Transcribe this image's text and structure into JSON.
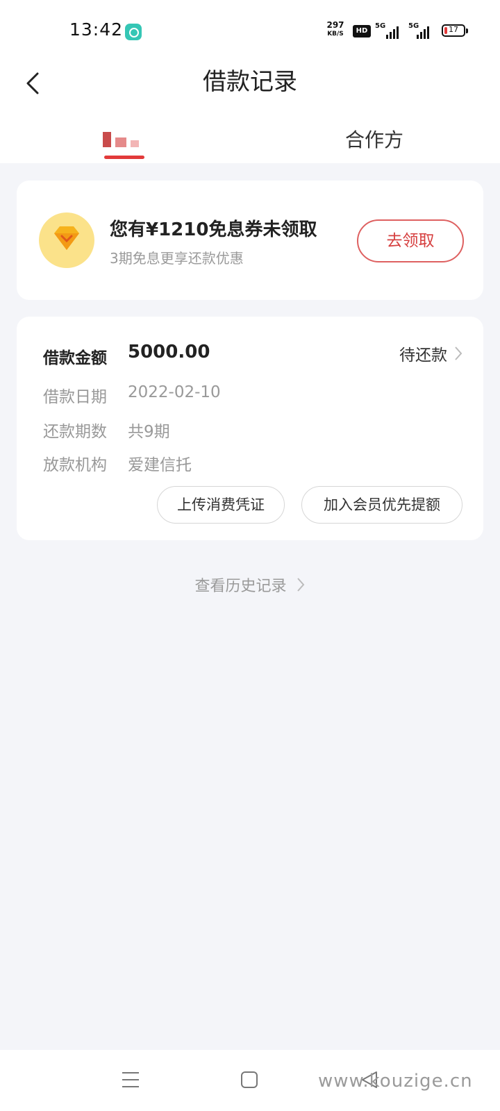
{
  "status_bar": {
    "time": "13:42",
    "net_speed_value": "297",
    "net_speed_unit": "KB/S",
    "hd_label": "HD",
    "signal_1_label": "5G",
    "signal_2_label": "5G",
    "battery_level": "17",
    "battery_fraction": 0.17,
    "battery_color": "#e23b3b"
  },
  "header": {
    "title": "借款记录",
    "tabs": [
      {
        "label": "",
        "active": true
      },
      {
        "label": "合作方",
        "active": false
      }
    ],
    "accent_color": "#e23a3a"
  },
  "coupon": {
    "title": "您有¥1210免息券未领取",
    "subtitle": "3期免息更享还款优惠",
    "button_label": "去领取",
    "icon": "gem-badge-icon"
  },
  "loan": {
    "amount_label": "借款金额",
    "amount_value": "5000.00",
    "status": "待还款",
    "rows": [
      {
        "label": "借款日期",
        "value": "2022-02-10"
      },
      {
        "label": "还款期数",
        "value": "共9期"
      },
      {
        "label": "放款机构",
        "value": "爱建信托"
      }
    ],
    "buttons": [
      "上传消费凭证",
      "加入会员优先提额"
    ]
  },
  "history_link": "查看历史记录",
  "nav_bar": {
    "icons": [
      "menu-icon",
      "home-square-icon",
      "back-triangle-icon"
    ]
  },
  "watermark": "www.kouzige.cn"
}
